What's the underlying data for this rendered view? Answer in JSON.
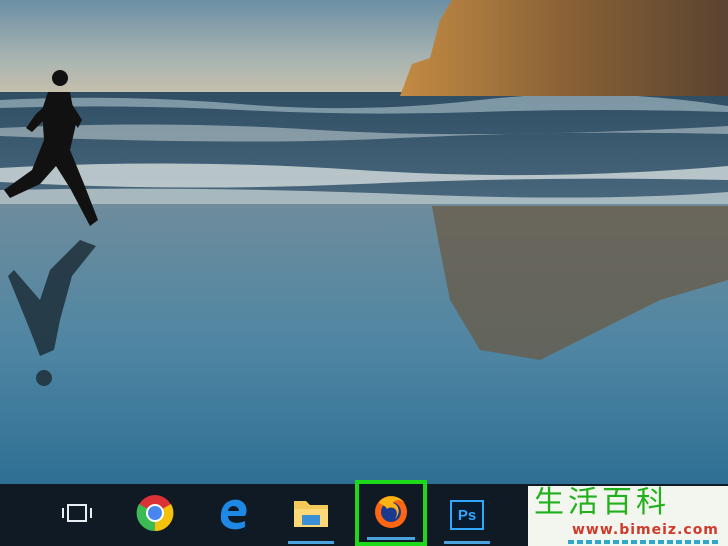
{
  "desktop": {
    "wallpaper_description": ""
  },
  "taskbar": {
    "items": [
      {
        "name": "Task View",
        "icon": "task-view-icon"
      },
      {
        "name": "Google Chrome",
        "icon": "chrome-icon"
      },
      {
        "name": "Microsoft Edge",
        "icon": "edge-icon"
      },
      {
        "name": "File Explorer",
        "icon": "folder-icon"
      },
      {
        "name": "Firefox",
        "icon": "firefox-icon",
        "highlighted": true
      },
      {
        "name": "Photoshop",
        "icon": "photoshop-icon",
        "label": "Ps"
      }
    ],
    "highlight_color": "#1ed91a"
  },
  "watermark": {
    "title": "生活百科",
    "url": "www.bimeiz.com"
  },
  "colors": {
    "taskbar_bg": "#0f1a24",
    "accent": "#4aa3df"
  }
}
